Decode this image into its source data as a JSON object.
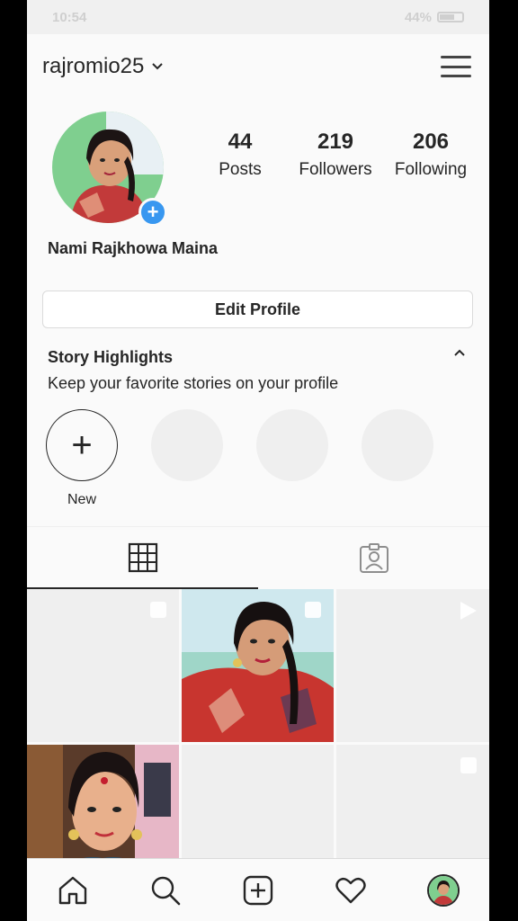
{
  "status_bar": {
    "time": "10:54",
    "battery": "44%"
  },
  "header": {
    "username": "rajromio25"
  },
  "profile": {
    "full_name": "Nami Rajkhowa Maina"
  },
  "stats": [
    {
      "value": "44",
      "label": "Posts"
    },
    {
      "value": "219",
      "label": "Followers"
    },
    {
      "value": "206",
      "label": "Following"
    }
  ],
  "edit_profile_label": "Edit Profile",
  "highlights": {
    "title": "Story Highlights",
    "subtitle": "Keep your favorite stories on your profile",
    "new_label": "New",
    "new_symbol": "+"
  },
  "tabs": [
    {
      "icon": "grid-icon",
      "active": true
    },
    {
      "icon": "tagged-photos-icon",
      "active": false
    }
  ],
  "grid_posts": [
    {
      "type": "multiple",
      "image": "blank"
    },
    {
      "type": "multiple",
      "image": "portrait-red-outfit"
    },
    {
      "type": "video",
      "image": "blank"
    },
    {
      "type": "photo",
      "image": "portrait-blue-outfit"
    },
    {
      "type": "photo",
      "image": "blank"
    },
    {
      "type": "multiple",
      "image": "blank"
    }
  ],
  "bottom_nav": [
    "home-icon",
    "search-icon",
    "new-post-icon",
    "activity-heart-icon",
    "profile-avatar"
  ],
  "colors": {
    "accent": "#3897f0",
    "text": "#262626",
    "background": "#fafafa",
    "placeholder": "#efefef"
  }
}
